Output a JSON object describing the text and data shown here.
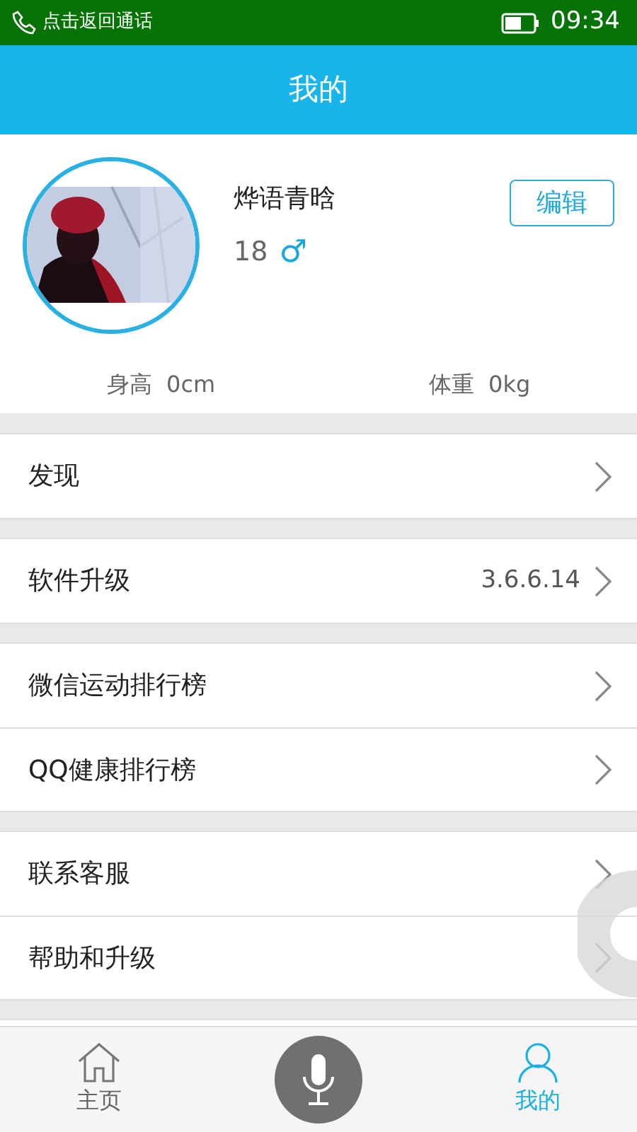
{
  "status_bar": {
    "call_text": "点击返回通话",
    "time": "09:34"
  },
  "header": {
    "title": "我的"
  },
  "profile": {
    "name": "烨语青晗",
    "age": "18",
    "gender": "♂",
    "edit_button": "编辑",
    "stats": [
      {
        "label": "身高",
        "value": "0cm"
      },
      {
        "label": "体重",
        "value": "0kg"
      }
    ]
  },
  "menu_groups": [
    [
      {
        "label": "发现"
      }
    ],
    [
      {
        "label": "软件升级",
        "value": "3.6.6.14"
      }
    ],
    [
      {
        "label": "微信运动排行榜"
      },
      {
        "label": "QQ健康排行榜"
      }
    ],
    [
      {
        "label": "联系客服"
      },
      {
        "label": "帮助和升级"
      }
    ]
  ],
  "tab_bar": [
    {
      "kind": "home",
      "label": "主页",
      "selected": false
    },
    {
      "kind": "mic",
      "selected": false
    },
    {
      "kind": "person",
      "label": "我的",
      "selected": true
    }
  ]
}
